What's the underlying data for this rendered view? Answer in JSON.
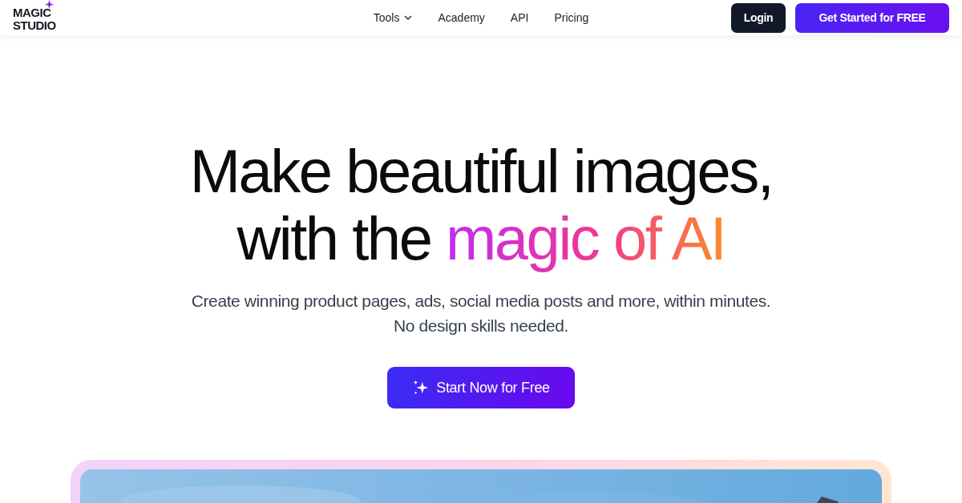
{
  "logo": {
    "line_1": "MAGIC",
    "line_2": "STUDIO"
  },
  "nav": [
    {
      "label": "Tools",
      "kind": "dropdown"
    },
    {
      "label": "Academy",
      "kind": "link"
    },
    {
      "label": "API",
      "kind": "link"
    },
    {
      "label": "Pricing",
      "kind": "link"
    }
  ],
  "header_buttons": [
    {
      "label": "Login",
      "kind": "dark"
    },
    {
      "label": "Get Started for FREE",
      "kind": "primary"
    }
  ],
  "hero": {
    "title_line_1": "Make beautiful images,",
    "title_line_2": "with the ",
    "title_highlight": "magic of AI",
    "subtitle": "Create winning product pages, ads, social media posts and more, within minutes. No design skills needed.",
    "cta": "Start Now for Free"
  }
}
